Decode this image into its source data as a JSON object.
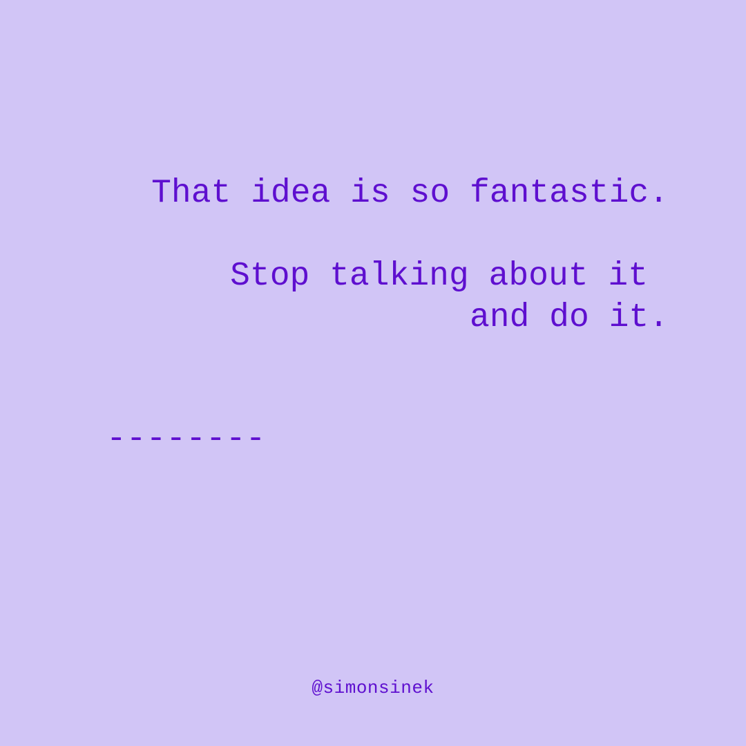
{
  "quote": {
    "line1": "That idea is so fantastic.",
    "line2": "Stop talking about it",
    "line3": "and do it."
  },
  "divider": "--------",
  "handle": "@simonsinek",
  "colors": {
    "background": "#d1c5f6",
    "text": "#5e0fcf"
  }
}
